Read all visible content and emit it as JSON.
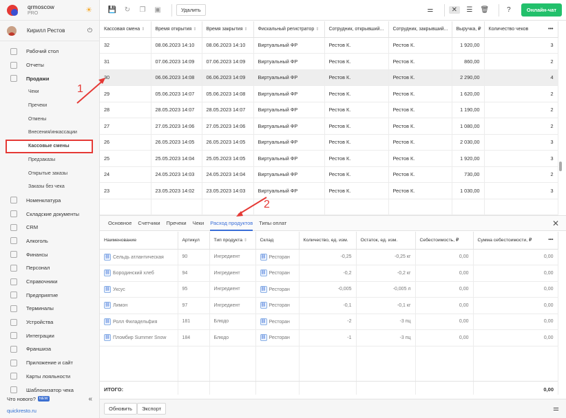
{
  "brand": {
    "name": "qrmoscow",
    "plan": "PRO"
  },
  "user": {
    "name": "Кирилл Рестов"
  },
  "nav": {
    "items_top": [
      "Рабочий стол",
      "Отчеты",
      "Продажи"
    ],
    "sales_sub": [
      "Чеки",
      "Пречеки",
      "Отмены",
      "Внесения/инкассации",
      "Кассовые смены",
      "Предзаказы",
      "Открытые заказы",
      "Заказы без чека"
    ],
    "items_bottom": [
      "Номенклатура",
      "Складские документы",
      "CRM",
      "Алкоголь",
      "Финансы",
      "Персонал",
      "Справочники",
      "Предприятие",
      "Терминалы",
      "Устройства",
      "Интеграции",
      "Франшиза",
      "Приложение и сайт",
      "Карты лояльности",
      "Шаблонизатор чека"
    ],
    "whats_new": "Что нового?",
    "new_badge": "NEW",
    "footer_link": "quickresto.ru"
  },
  "toolbar": {
    "delete_label": "Удалить",
    "online_chat": "Онлайн-чат"
  },
  "main_table": {
    "columns": [
      "Кассовая смена",
      "Время открытия",
      "Время закрытия",
      "Фискальный регистратор",
      "Сотрудник, открывший...",
      "Сотрудник, закрывший...",
      "Выручка, ₽",
      "Количество чеков"
    ],
    "rows": [
      [
        "32",
        "08.06.2023 14:10",
        "08.06.2023 14:10",
        "Виртуальный ФР",
        "Рестов К.",
        "Рестов К.",
        "1 920,00",
        "3"
      ],
      [
        "31",
        "07.06.2023 14:09",
        "07.06.2023 14:09",
        "Виртуальный ФР",
        "Рестов К.",
        "Рестов К.",
        "860,00",
        "2"
      ],
      [
        "30",
        "06.06.2023 14:08",
        "06.06.2023 14:09",
        "Виртуальный ФР",
        "Рестов К.",
        "Рестов К.",
        "2 290,00",
        "4"
      ],
      [
        "29",
        "05.06.2023 14:07",
        "05.06.2023 14:08",
        "Виртуальный ФР",
        "Рестов К.",
        "Рестов К.",
        "1 620,00",
        "2"
      ],
      [
        "28",
        "28.05.2023 14:07",
        "28.05.2023 14:07",
        "Виртуальный ФР",
        "Рестов К.",
        "Рестов К.",
        "1 190,00",
        "2"
      ],
      [
        "27",
        "27.05.2023 14:06",
        "27.05.2023 14:06",
        "Виртуальный ФР",
        "Рестов К.",
        "Рестов К.",
        "1 080,00",
        "2"
      ],
      [
        "26",
        "26.05.2023 14:05",
        "26.05.2023 14:05",
        "Виртуальный ФР",
        "Рестов К.",
        "Рестов К.",
        "2 030,00",
        "3"
      ],
      [
        "25",
        "25.05.2023 14:04",
        "25.05.2023 14:05",
        "Виртуальный ФР",
        "Рестов К.",
        "Рестов К.",
        "1 920,00",
        "3"
      ],
      [
        "24",
        "24.05.2023 14:03",
        "24.05.2023 14:04",
        "Виртуальный ФР",
        "Рестов К.",
        "Рестов К.",
        "730,00",
        "2"
      ],
      [
        "23",
        "23.05.2023 14:02",
        "23.05.2023 14:03",
        "Виртуальный ФР",
        "Рестов К.",
        "Рестов К.",
        "1 030,00",
        "3"
      ]
    ]
  },
  "detail_tabs": [
    "Основное",
    "Счетчики",
    "Пречеки",
    "Чеки",
    "Расход продуктов",
    "Типы оплат"
  ],
  "detail_table": {
    "columns": [
      "Наименование",
      "Артикул",
      "Тип продукта",
      "Склад",
      "Количество, ед. изм.",
      "Остаток, ед. изм.",
      "Себестоимость, ₽",
      "Сумма себестоимости, ₽"
    ],
    "rows": [
      [
        "Сельдь атлантическая",
        "90",
        "Ингредиент",
        "Ресторан",
        "-0,25",
        "-0,25 кг",
        "0,00",
        "0,00"
      ],
      [
        "Бородинский хлеб",
        "94",
        "Ингредиент",
        "Ресторан",
        "-0,2",
        "-0,2 кг",
        "0,00",
        "0,00"
      ],
      [
        "Уксус",
        "95",
        "Ингредиент",
        "Ресторан",
        "-0,005",
        "-0,005 л",
        "0,00",
        "0,00"
      ],
      [
        "Лимон",
        "97",
        "Ингредиент",
        "Ресторан",
        "-0,1",
        "-0,1 кг",
        "0,00",
        "0,00"
      ],
      [
        "Ролл Филадельфия",
        "181",
        "Блюдо",
        "Ресторан",
        "-2",
        "-3 пц",
        "0,00",
        "0,00"
      ],
      [
        "Пломбир Summer Snow",
        "184",
        "Блюдо",
        "Ресторан",
        "-1",
        "-3 пц",
        "0,00",
        "0,00"
      ]
    ],
    "total_label": "ИТОГО:",
    "total_value": "0,00"
  },
  "bottom_bar": {
    "refresh": "Обновить",
    "export": "Экспорт"
  },
  "annotations": {
    "one": "1",
    "two": "2"
  }
}
